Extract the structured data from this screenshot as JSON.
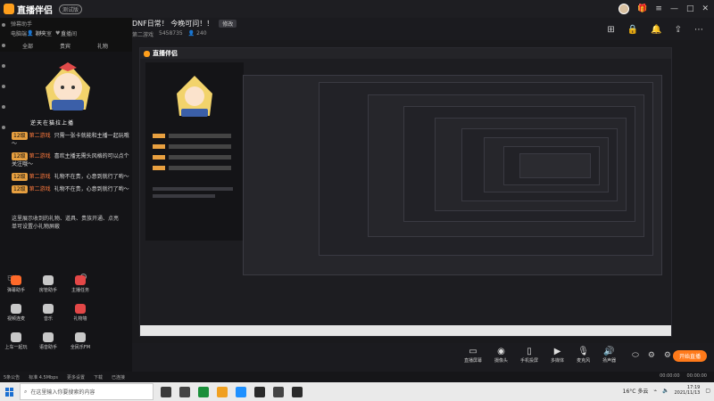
{
  "app": {
    "name": "直播伴侣",
    "badge": "测试版",
    "window_controls": [
      "menu-icon",
      "minimize-icon",
      "maximize-icon",
      "close-icon"
    ]
  },
  "room": {
    "title": "DNF日常！ 今晚可问！！",
    "edit_label": "修改",
    "category": "第二游戏",
    "room_id": "5458735",
    "viewers": "240",
    "tool_icons": [
      "layout-icon",
      "lock-icon",
      "bell-icon",
      "share-icon",
      "more-icon"
    ]
  },
  "left_panel": {
    "header_label": "弹幕助手",
    "tabs": [
      "电脑端",
      "聊天室",
      "直播间"
    ],
    "stat_viewers": "240",
    "stat_fans": "6",
    "sub_tabs": [
      "全部",
      "贵宾",
      "礼物"
    ],
    "streamer_caption": "逆天在猫拉上播",
    "chat": [
      {
        "badge": "12级",
        "user": "第二游戏",
        "text": "只需一张卡就能和主播一起玩哦～"
      },
      {
        "badge": "12级",
        "user": "第二游戏",
        "text": "喜欢主播无需头风格的可以点个关注哦～"
      },
      {
        "badge": "12级",
        "user": "第二游戏",
        "text": "礼物不在贵，心意到就行了哟～"
      },
      {
        "badge": "12级",
        "user": "第二游戏",
        "text": "礼物不在贵，心意到就行了哟～"
      }
    ],
    "notice": "这里展示收到的礼物、道具、贵族开通、点亮单可设置小礼物屏蔽",
    "bottom_label": "已读"
  },
  "tools": [
    {
      "label": "弹幕助手",
      "color": "#ff6a2a"
    },
    {
      "label": "房管助手",
      "color": "#c8c8c8"
    },
    {
      "label": "主播任务",
      "color": "#e34747"
    },
    {
      "label": "视频连麦",
      "color": "#c8c8c8"
    },
    {
      "label": "音乐",
      "color": "#c8c8c8"
    },
    {
      "label": "礼物墙",
      "color": "#e34747"
    },
    {
      "label": "上车一起玩",
      "color": "#c8c8c8"
    },
    {
      "label": "语音助手",
      "color": "#c8c8c8"
    },
    {
      "label": "全民乐FM",
      "color": "#c8c8c8"
    }
  ],
  "preview": {
    "inner_app_name": "直播伴侣"
  },
  "controls": {
    "items": [
      {
        "label": "直播屏幕",
        "icon": "screen-icon"
      },
      {
        "label": "摄像头",
        "icon": "camera-icon"
      },
      {
        "label": "手机投屏",
        "icon": "phone-icon"
      },
      {
        "label": "多媒体",
        "icon": "media-icon"
      },
      {
        "label": "麦克风",
        "icon": "mic-icon"
      },
      {
        "label": "扬声器",
        "icon": "speaker-icon"
      }
    ],
    "go_live_label": "开始直播"
  },
  "status": {
    "items": [
      "5条公告",
      "标准 4.5Mbps",
      "更多设置",
      "下载",
      "已连接"
    ],
    "right": [
      "00:00:00",
      "00:00:00"
    ]
  },
  "taskbar": {
    "search_placeholder": "在这里输入你要搜索的内容",
    "app_colors": [
      "#3a3a3a",
      "#444",
      "#1a8f3a",
      "#f0a020",
      "#1e90ff",
      "#2a2a2a",
      "#444",
      "#2b2b2b"
    ],
    "weather": "16°C 多云",
    "time": "17:19",
    "date": "2021/11/13"
  }
}
